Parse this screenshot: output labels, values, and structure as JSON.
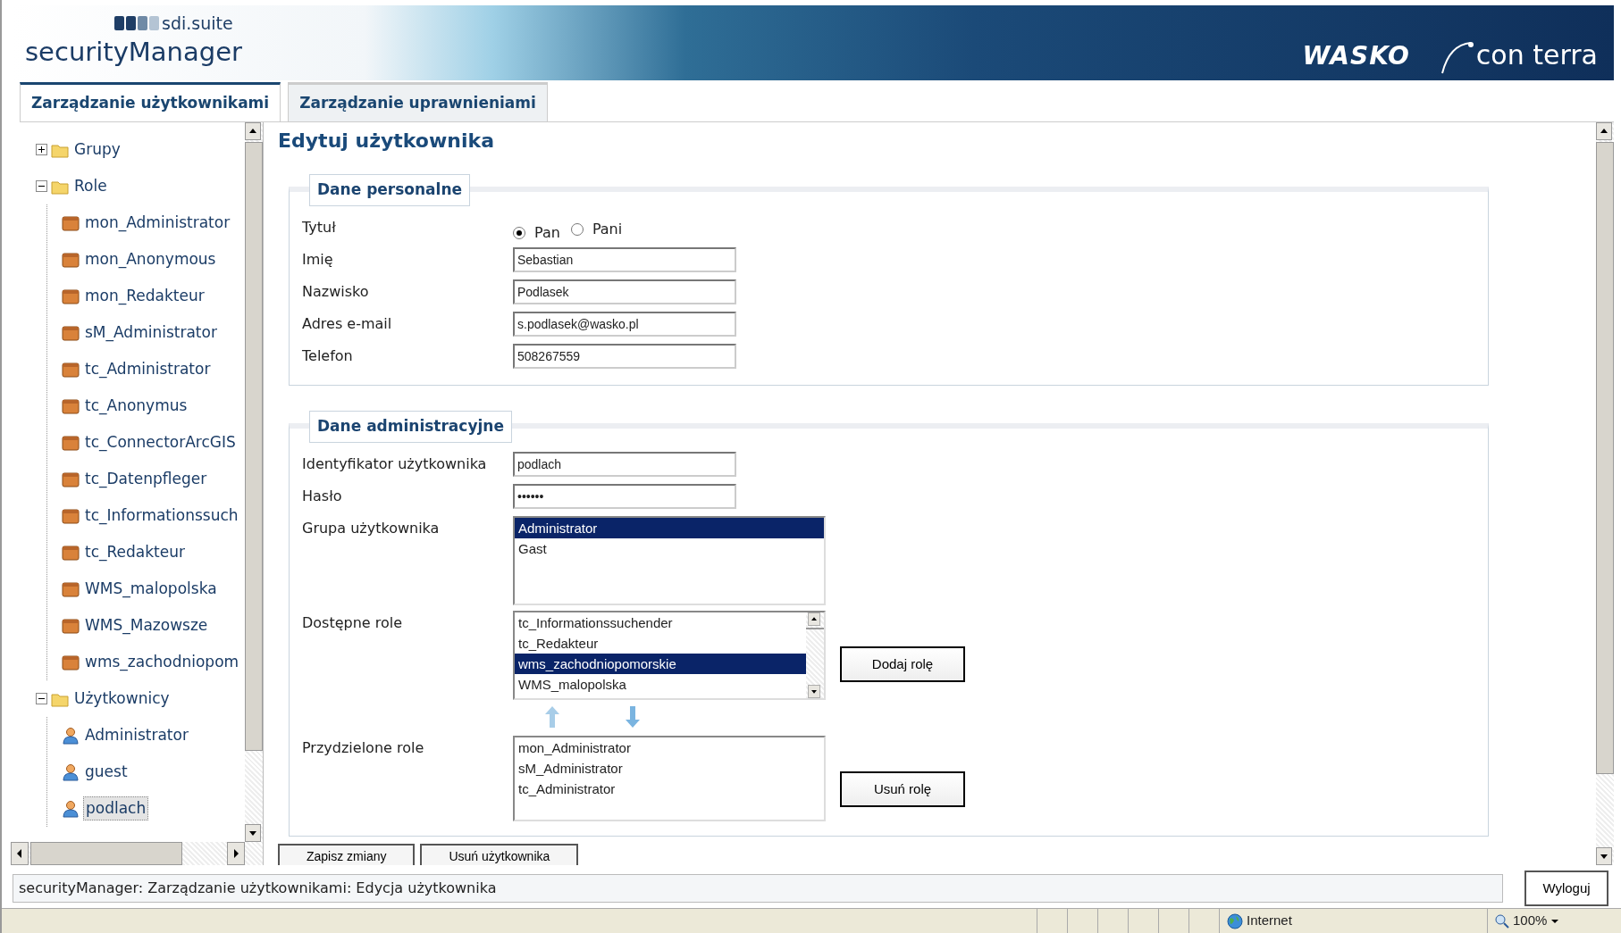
{
  "header": {
    "suite": "sdi.suite",
    "product": "securityManager",
    "logos": [
      "WASKO",
      "con terra"
    ]
  },
  "tabs": [
    {
      "label": "Zarządzanie użytkownikami",
      "selected": true
    },
    {
      "label": "Zarządzanie uprawnieniami",
      "selected": false
    }
  ],
  "tree": [
    {
      "label": "Grupy",
      "kind": "folder",
      "expanded": false,
      "selected": false
    },
    {
      "label": "Role",
      "kind": "folder",
      "expanded": true,
      "selected": false,
      "children": [
        {
          "label": "mon_Administrator",
          "kind": "role",
          "selected": false
        },
        {
          "label": "mon_Anonymous",
          "kind": "role",
          "selected": false
        },
        {
          "label": "mon_Redakteur",
          "kind": "role",
          "selected": false
        },
        {
          "label": "sM_Administrator",
          "kind": "role",
          "selected": false
        },
        {
          "label": "tc_Administrator",
          "kind": "role",
          "selected": false
        },
        {
          "label": "tc_Anonymus",
          "kind": "role",
          "selected": false
        },
        {
          "label": "tc_ConnectorArcGIS",
          "kind": "role",
          "selected": false
        },
        {
          "label": "tc_Datenpfleger",
          "kind": "role",
          "selected": false
        },
        {
          "label": "tc_Informationssuch",
          "kind": "role",
          "selected": false
        },
        {
          "label": "tc_Redakteur",
          "kind": "role",
          "selected": false
        },
        {
          "label": "WMS_malopolska",
          "kind": "role",
          "selected": false
        },
        {
          "label": "WMS_Mazowsze",
          "kind": "role",
          "selected": false
        },
        {
          "label": "wms_zachodniopom",
          "kind": "role",
          "selected": false
        }
      ]
    },
    {
      "label": "Użytkownicy",
      "kind": "folder",
      "expanded": true,
      "selected": false,
      "children": [
        {
          "label": "Administrator",
          "kind": "user",
          "selected": false
        },
        {
          "label": "guest",
          "kind": "user",
          "selected": false
        },
        {
          "label": "podlach",
          "kind": "user",
          "selected": true
        }
      ]
    }
  ],
  "form": {
    "title": "Edytuj użytkownika",
    "personal": {
      "legend": "Dane personalne",
      "salutation": {
        "label": "Tytuł",
        "options": [
          {
            "label": "Pan",
            "selected": true
          },
          {
            "label": "Pani",
            "selected": false
          }
        ]
      },
      "fields": [
        {
          "label": "Imię",
          "value": "Sebastian"
        },
        {
          "label": "Nazwisko",
          "value": "Podlasek"
        },
        {
          "label": "Adres e-mail",
          "value": "s.podlasek@wasko.pl"
        },
        {
          "label": "Telefon",
          "value": "508267559"
        }
      ]
    },
    "admin": {
      "legend": "Dane administracyjne",
      "fields": [
        {
          "label": "Identyfikator użytkownika",
          "value": "podlach"
        },
        {
          "label": "Hasło",
          "value": "••••••"
        }
      ],
      "group": {
        "label": "Grupa użytkownika",
        "options": [
          {
            "label": "Administrator",
            "selected": true
          },
          {
            "label": "Gast",
            "selected": false
          }
        ]
      },
      "available_roles": {
        "label": "Dostępne role",
        "button": "Dodaj rolę",
        "options": [
          {
            "label": "tc_Informationssuchender",
            "selected": false
          },
          {
            "label": "tc_Redakteur",
            "selected": false
          },
          {
            "label": "wms_zachodniopomorskie",
            "selected": true
          },
          {
            "label": "WMS_malopolska",
            "selected": false
          }
        ]
      },
      "assigned_roles": {
        "label": "Przydzielone role",
        "button": "Usuń rolę",
        "options": [
          {
            "label": "mon_Administrator",
            "selected": false
          },
          {
            "label": "sM_Administrator",
            "selected": false
          },
          {
            "label": "tc_Administrator",
            "selected": false
          }
        ]
      }
    },
    "buttons": [
      "Zapisz zmiany",
      "Usuń użytkownika"
    ]
  },
  "status_line": "securityManager: Zarządzanie użytkownikami: Edycja użytkownika",
  "logout": "Wyloguj",
  "browser_status": {
    "zone": "Internet",
    "zoom": "100%"
  }
}
